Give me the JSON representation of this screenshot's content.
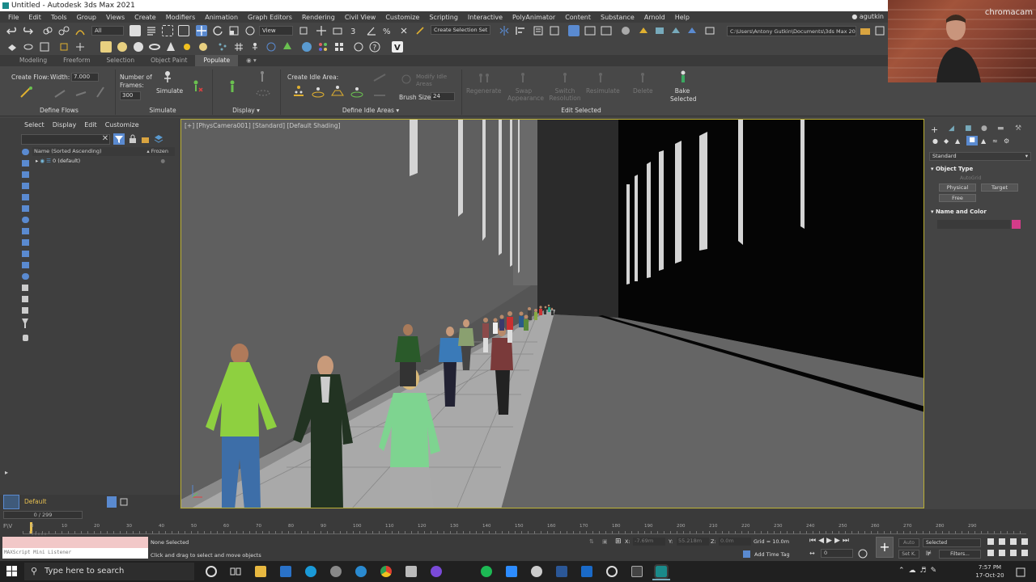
{
  "window": {
    "title": "Untitled - Autodesk 3ds Max 2021"
  },
  "menu": [
    "File",
    "Edit",
    "Tools",
    "Group",
    "Views",
    "Create",
    "Modifiers",
    "Animation",
    "Graph Editors",
    "Rendering",
    "Civil View",
    "Customize",
    "Scripting",
    "Interactive",
    "PolyAnimator",
    "Content",
    "Substance",
    "Arnold",
    "Help"
  ],
  "user": "agutkin",
  "toolbar": {
    "selection_filter": "All",
    "view_dropdown": "View",
    "selection_set": "Create Selection Set",
    "project_path": "C:\\Users\\Antony Gutkin\\Documents\\3ds Max 2021"
  },
  "ribbon_tabs": [
    "Modeling",
    "Freeform",
    "Selection",
    "Object Paint",
    "Populate"
  ],
  "ribbon": {
    "create_flow": "Create Flow:",
    "width_label": "Width:",
    "width_value": "7.000",
    "number_of_frames": "Number of Frames:",
    "frames_value": "300",
    "simulate": "Simulate",
    "create_idle_area": "Create Idle Area:",
    "modify_idle_areas": "Modify Idle Areas",
    "brush_size_label": "Brush Size:",
    "brush_size_value": "24",
    "regenerate": "Regenerate",
    "swap_appearance": "Swap Appearance",
    "switch_resolution": "Switch Resolution",
    "resimulate": "Resimulate",
    "delete": "Delete",
    "bake_selected": "Bake Selected",
    "groups": [
      "Define Flows",
      "Simulate",
      "Display ▾",
      "Define Idle Areas ▾",
      "Edit Selected"
    ]
  },
  "webcam": {
    "watermark": "chromacam"
  },
  "scene_explorer": {
    "menu": [
      "Select",
      "Display",
      "Edit",
      "Customize"
    ],
    "col_name": "Name (Sorted Ascending)",
    "col_frozen": "▴ Frozen",
    "row": "0 (default)",
    "layer": "Default"
  },
  "viewport": {
    "label": "[+] [PhysCamera001] [Standard] [Default Shading]"
  },
  "command_panel": {
    "dropdown": "Standard",
    "object_type": "Object Type",
    "autogrid": "AutoGrid",
    "physical": "Physical",
    "target": "Target",
    "free": "Free",
    "name_and_color": "Name and Color",
    "color": "#d43c8a"
  },
  "timeline": {
    "frame_counter": "0 / 299",
    "ticks": [
      "0",
      "10",
      "20",
      "30",
      "40",
      "50",
      "60",
      "70",
      "80",
      "90",
      "100",
      "110",
      "120",
      "130",
      "140",
      "150",
      "160",
      "170",
      "180",
      "190",
      "200",
      "210",
      "220",
      "230",
      "240",
      "250",
      "260",
      "270",
      "280",
      "290"
    ]
  },
  "status": {
    "maxscript": "MAXScript Mini Listener",
    "none_selected": "None Selected",
    "hint": "Click and drag to select and move objects",
    "x_label": "X:",
    "x_value": "-7.69m",
    "y_label": "Y:",
    "y_value": "55.218m",
    "z_label": "Z:",
    "z_value": "0.0m",
    "grid": "Grid = 10.0m",
    "add_time_tag": "Add Time Tag",
    "auto": "Auto",
    "selected": "Selected",
    "set_k": "Set K.",
    "filters": "Filters..."
  },
  "taskbar": {
    "search_placeholder": "Type here to search",
    "time": "7:57 PM",
    "date": "17-Oct-20"
  }
}
